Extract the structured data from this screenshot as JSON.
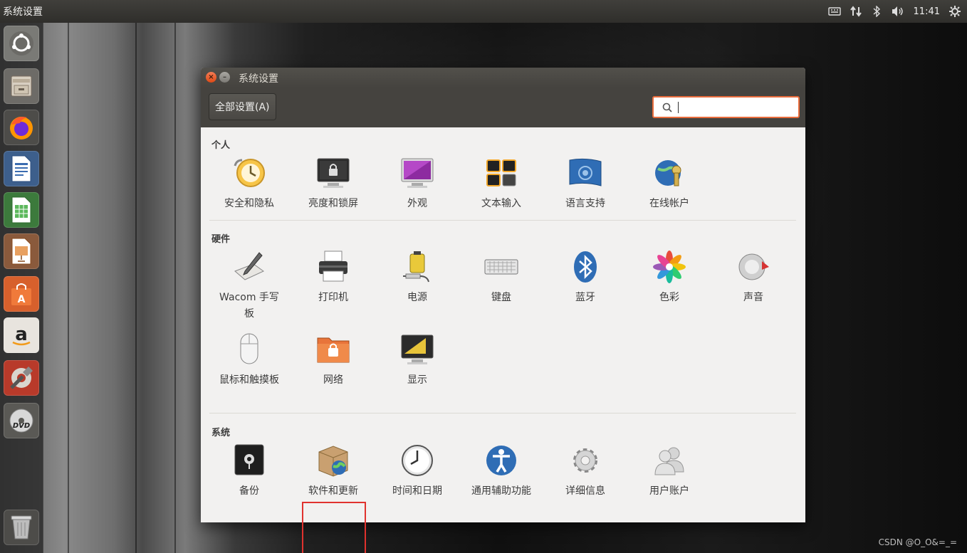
{
  "top_panel": {
    "app_title": "系统设置",
    "time": "11:41",
    "indicators": [
      "keyboard-icon",
      "network-arrows-icon",
      "bluetooth-icon",
      "volume-icon",
      "gear-icon"
    ]
  },
  "launcher": {
    "items": [
      {
        "name": "ubuntu-dash",
        "icon": "ubuntu-logo-icon"
      },
      {
        "name": "files",
        "icon": "file-cabinet-icon"
      },
      {
        "name": "firefox",
        "icon": "firefox-icon"
      },
      {
        "name": "writer",
        "icon": "writer-document-icon"
      },
      {
        "name": "calc",
        "icon": "calc-spreadsheet-icon"
      },
      {
        "name": "impress",
        "icon": "impress-presentation-icon"
      },
      {
        "name": "software-center",
        "icon": "shopping-bag-icon"
      },
      {
        "name": "amazon",
        "icon": "amazon-icon"
      },
      {
        "name": "system-settings",
        "icon": "settings-tools-icon"
      },
      {
        "name": "dvd",
        "icon": "dvd-icon"
      },
      {
        "name": "trash",
        "icon": "trash-icon"
      }
    ]
  },
  "window": {
    "title": "系统设置",
    "all_settings_button": "全部设置(A)",
    "search_placeholder": ""
  },
  "sections": {
    "personal": {
      "title": "个人",
      "items": [
        "安全和隐私",
        "亮度和锁屏",
        "外观",
        "文本输入",
        "语言支持",
        "在线帐户"
      ]
    },
    "hardware": {
      "title": "硬件",
      "items": [
        "Wacom 手写",
        "打印机",
        "电源",
        "键盘",
        "蓝牙",
        "色彩",
        "声音",
        "鼠标和触摸板",
        "网络",
        "显示"
      ],
      "wacom_line2": "板"
    },
    "system": {
      "title": "系统",
      "items": [
        "备份",
        "软件和更新",
        "时间和日期",
        "通用辅助功能",
        "详细信息",
        "用户账户"
      ]
    }
  },
  "watermark": "CSDN @O_O&=_=",
  "colors": {
    "accent": "#e96c3c",
    "highlight_box": "#e0322e",
    "panel": "#3c3b37"
  }
}
